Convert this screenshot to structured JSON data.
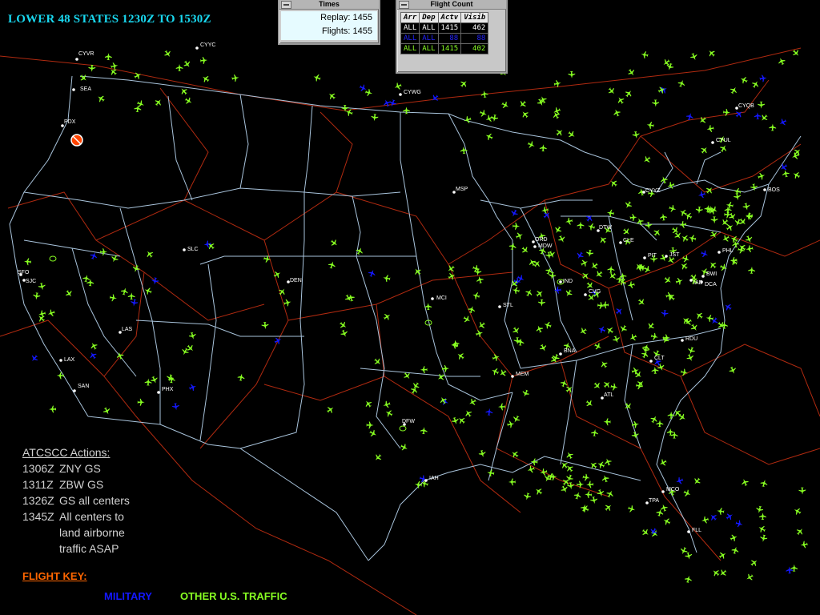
{
  "title": "LOWER 48 STATES 1230Z TO 1530Z",
  "times_window": {
    "title": "Times",
    "replay": "Replay: 1455",
    "flights": "Flights: 1455"
  },
  "flight_count_window": {
    "title": "Flight Count",
    "headers": [
      "Arr",
      "Dep",
      "Actv",
      "Visib"
    ],
    "rows": [
      {
        "arr": "ALL",
        "dep": "ALL",
        "actv": "1415",
        "visib": "462",
        "color": "#ffffff"
      },
      {
        "arr": "ALL",
        "dep": "ALL",
        "actv": "88",
        "visib": "88",
        "color": "#2222ff"
      },
      {
        "arr": "ALL",
        "dep": "ALL",
        "actv": "1415",
        "visib": "402",
        "color": "#88ff22"
      }
    ]
  },
  "actions": {
    "heading": "ATCSCC Actions:",
    "items": [
      {
        "time": "1306Z",
        "lines": [
          "ZNY GS"
        ]
      },
      {
        "time": "1311Z",
        "lines": [
          "ZBW GS"
        ]
      },
      {
        "time": "1326Z",
        "lines": [
          "GS all centers"
        ]
      },
      {
        "time": "1345Z",
        "lines": [
          "All centers to",
          "land airborne",
          "traffic ASAP"
        ]
      }
    ]
  },
  "flight_key": {
    "label": "FLIGHT KEY:",
    "military": "MILITARY",
    "other": "OTHER U.S. TRAFFIC"
  },
  "colors": {
    "military": "#1418ff",
    "civil": "#88ff22",
    "title": "#19d8f0",
    "key": "#ff6600",
    "state_lines": "#a9c4dc",
    "center_lines": "#b02a10"
  },
  "airports": [
    "SEA",
    "PDX",
    "SFO",
    "SJC",
    "LAX",
    "SAN",
    "LAS",
    "PHX",
    "SLC",
    "DEN",
    "MSP",
    "MCI",
    "STL",
    "ORD",
    "MDW",
    "IND",
    "CVG",
    "DTW",
    "CLE",
    "PIT",
    "JST",
    "BOS",
    "PHL",
    "BWI",
    "IAD",
    "DCA",
    "RDU",
    "CLT",
    "ATL",
    "BNA",
    "MEM",
    "DFW",
    "IAH",
    "MCO",
    "TPA",
    "FLL",
    "CYYZ",
    "CYUL",
    "CYQB",
    "CYYC",
    "CYWG",
    "CYVR"
  ]
}
